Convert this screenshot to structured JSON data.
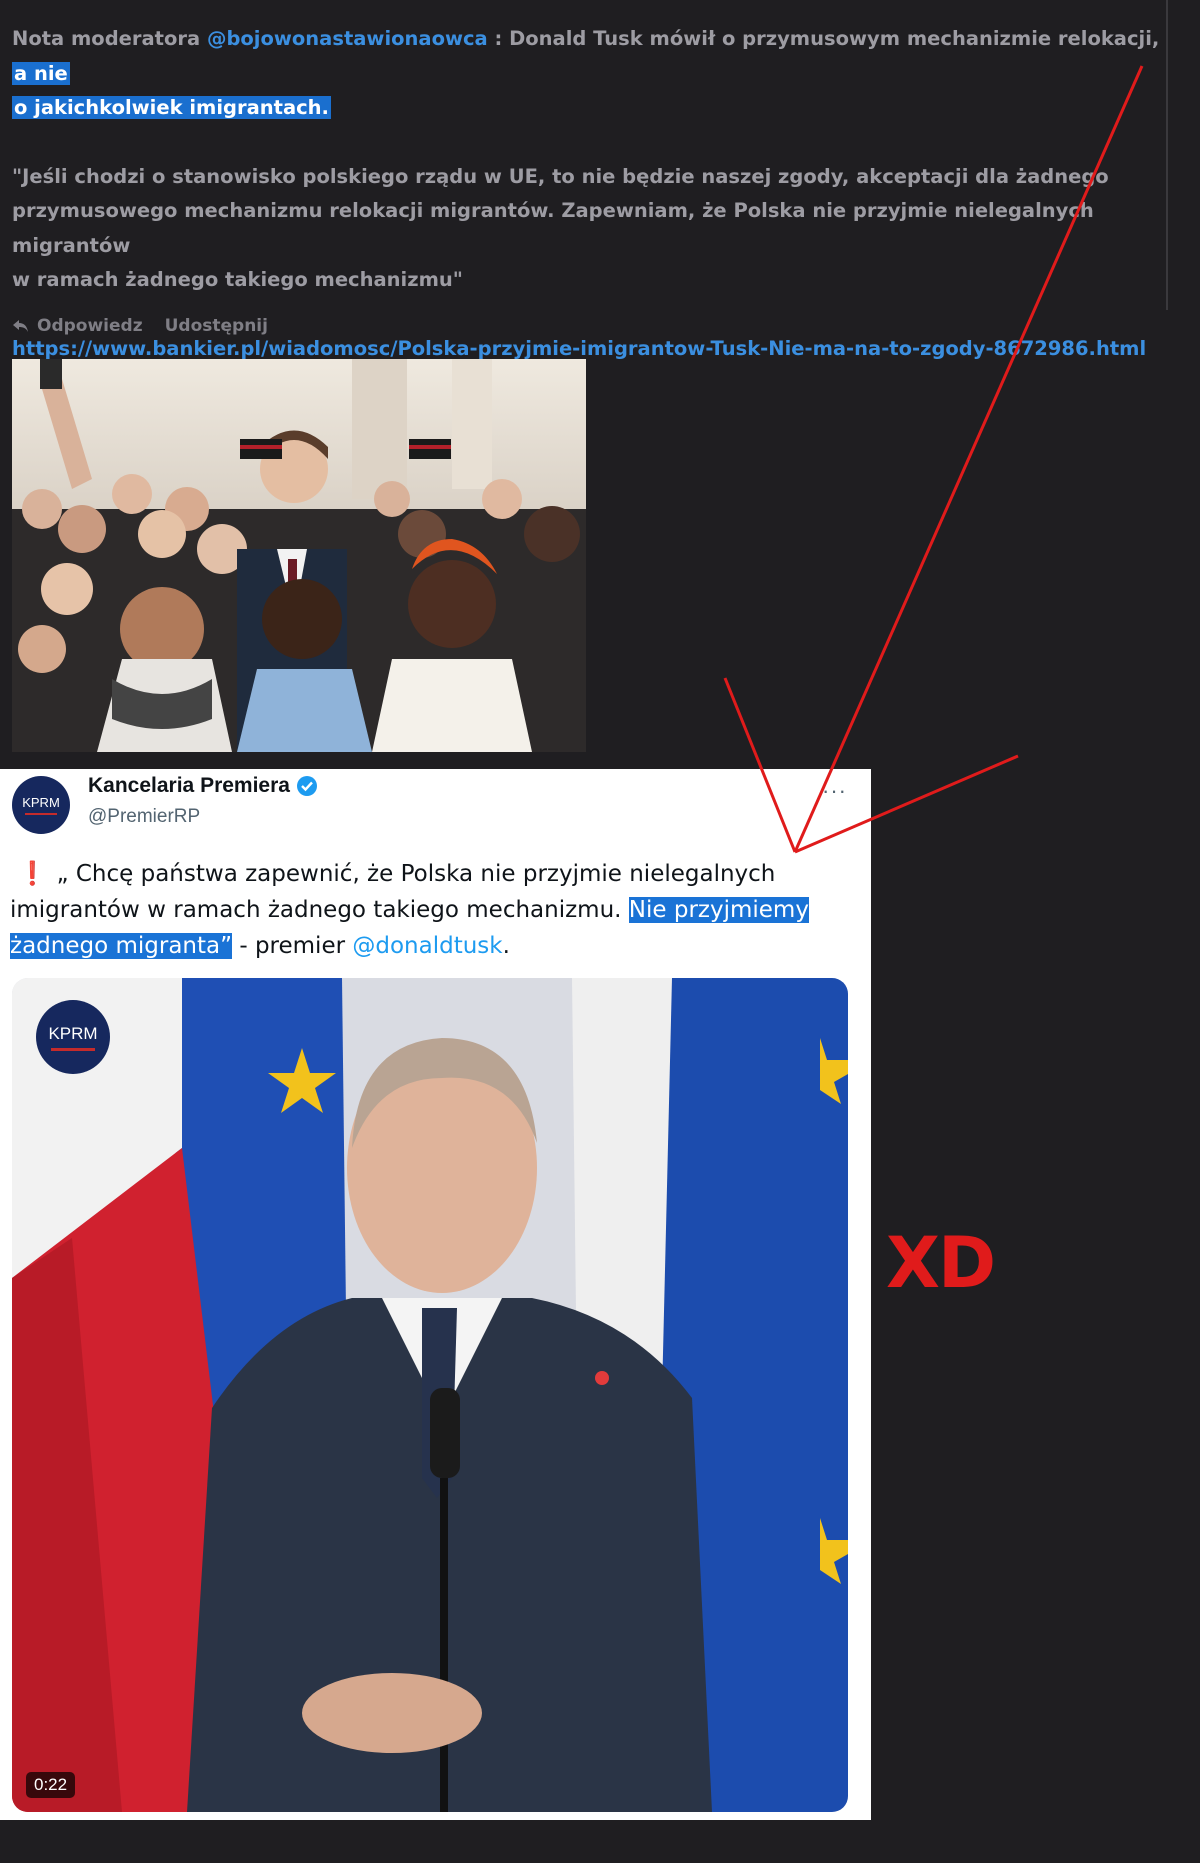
{
  "note": {
    "prefix": "Nota moderatora ",
    "mention": "@bojowonastawionaowca",
    "text_1": " : Donald Tusk mówił o przymusowym mechanizmie relokacji, ",
    "highlight_1": "a nie",
    "highlight_2": "o jakichkolwiek imigrantach.",
    "quote_line_1": "\"Jeśli chodzi o stanowisko polskiego rządu w UE, to nie będzie naszej zgody, akceptacji dla żadnego",
    "quote_line_2": "przymusowego mechanizmu relokacji migrantów. Zapewniam, że Polska nie przyjmie nielegalnych migrantów",
    "quote_line_3": "w ramach żadnego takiego mechanizmu\"",
    "link": "https://www.bankier.pl/wiadomosc/Polska-przyjmie-imigrantow-Tusk-Nie-ma-na-to-zgody-8672986.html"
  },
  "actions": {
    "reply": "Odpowiedz",
    "share": "Udostępnij"
  },
  "tweet": {
    "avatar_text": "KPRM",
    "name": "Kancelaria Premiera",
    "handle": "@PremierRP",
    "more": "···",
    "text_1": "„ Chcę państwa zapewnić, że Polska nie przyjmie nielegalnych",
    "text_2": "imigrantów w ramach żadnego takiego mechanizmu. ",
    "highlight_1": "Nie przyjmiemy",
    "highlight_2": "żadnego migranta”",
    "text_3": " - premier ",
    "mention": "@donaldtusk",
    "text_4": ".",
    "video_logo": "KPRM",
    "duration": "0:22"
  },
  "annotation": {
    "xd": "XD",
    "arrow_color": "#e01b1b"
  },
  "colors": {
    "background": "#1f1e21",
    "link": "#3b8fe0",
    "highlight": "#1a6fcf",
    "verified": "#1d9bf0"
  }
}
